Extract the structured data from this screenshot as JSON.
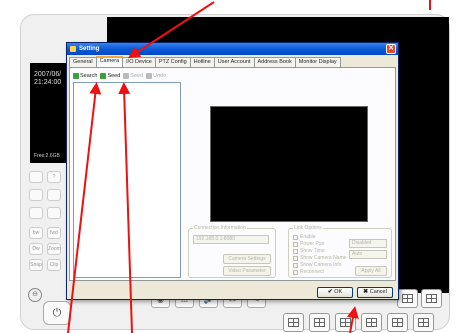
{
  "player": {
    "clock_date": "2007/06/",
    "clock_time": "21:24:00",
    "free_space": "Free:2.6GB",
    "side_buttons": [
      "",
      "?",
      "",
      "",
      "",
      "",
      "bw",
      "fwd",
      "Dw",
      "Zoom",
      "Snap",
      "Clip"
    ],
    "power_glyph": "⏻",
    "ring_glyph": "⊖",
    "toolbar_glyphs": [
      "◉",
      "⚠",
      "🔊",
      "✉",
      "✎"
    ]
  },
  "dialog": {
    "title": "Setting",
    "close_glyph": "✕",
    "tabs": [
      "General",
      "Camera",
      "I/O Device",
      "PTZ Config",
      "Hotline",
      "User Account",
      "Address Book",
      "Monitor Display"
    ],
    "active_tab": "Camera",
    "camera_tools": [
      {
        "label": "Search",
        "enabled": true
      },
      {
        "label": "Seed",
        "enabled": true
      },
      {
        "label": "Seed",
        "enabled": false
      },
      {
        "label": "Undo",
        "enabled": false
      }
    ],
    "connection": {
      "legend": "Connection Information",
      "ip_value": "192.168.0.1:8080",
      "camera_settings_label": "Camera Settings",
      "video_parameter_label": "Video Parameter"
    },
    "options": {
      "legend": "Link Options",
      "checkboxes": [
        "Enable",
        "Power Pan",
        "Show Time",
        "Show Camera Name",
        "Show Camera Info",
        "Reconnect"
      ],
      "select_1": "Disabled",
      "select_2": "Auto",
      "apply_label": "Apply All"
    },
    "ok_label": "OK",
    "cancel_label": "Cancel",
    "ok_glyph": "✔",
    "cancel_glyph": "✖"
  },
  "colors": {
    "annotation_arrow": "#ee1111",
    "title_bar": "#0a5bd8"
  }
}
